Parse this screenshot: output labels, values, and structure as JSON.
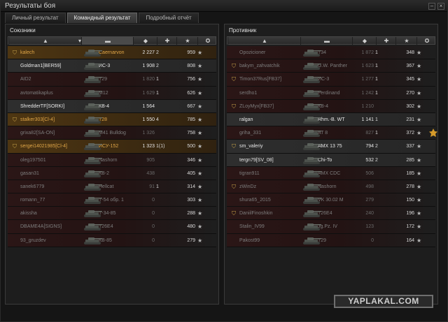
{
  "window": {
    "title": "Результаты боя"
  },
  "tabs": [
    {
      "label": "Личный результат",
      "active": false
    },
    {
      "label": "Командный результат",
      "active": true
    },
    {
      "label": "Подробный отчёт",
      "active": false
    }
  ],
  "allies": {
    "title": "Союзники",
    "players": [
      {
        "name": "kalech",
        "tank": "Caernarvon",
        "damage": "2 227",
        "frags": "2",
        "exp": "959",
        "platoon": true,
        "status": "me"
      },
      {
        "name": "Goldman1[BER59]",
        "tank": "ИС-3",
        "damage": "1 908",
        "frags": "2",
        "exp": "808",
        "platoon": false,
        "status": "alive"
      },
      {
        "name": "AID2",
        "tank": "T29",
        "damage": "1 820",
        "frags": "1",
        "exp": "756",
        "platoon": false,
        "status": "dead"
      },
      {
        "name": "avtomatikaplus",
        "tank": "M12",
        "damage": "1 629",
        "frags": "1",
        "exp": "626",
        "platoon": false,
        "status": "dead"
      },
      {
        "name": "ShredderTF[SORKI]",
        "tank": "КВ-4",
        "damage": "1 564",
        "frags": "",
        "exp": "667",
        "platoon": false,
        "status": "alive"
      },
      {
        "name": "stalker303[Cl-4]",
        "tank": "T28",
        "damage": "1 550",
        "frags": "4",
        "exp": "785",
        "platoon": true,
        "status": "me"
      },
      {
        "name": "grixa82[SA-ON]",
        "tank": "M41 Bulldog",
        "damage": "1 326",
        "frags": "",
        "exp": "758",
        "platoon": false,
        "status": "dead"
      },
      {
        "name": "sergei14021985[Cl-4]",
        "tank": "ИСУ-152",
        "damage": "1 323",
        "frags": "1(1)",
        "exp": "500",
        "platoon": true,
        "status": "me"
      },
      {
        "name": "oleg197501",
        "tank": "Nashorn",
        "damage": "905",
        "frags": "",
        "exp": "346",
        "platoon": false,
        "status": "dead"
      },
      {
        "name": "gasan31",
        "tank": "КВ-2",
        "damage": "438",
        "frags": "",
        "exp": "405",
        "platoon": false,
        "status": "dead"
      },
      {
        "name": "sanek6779",
        "tank": "Hellcat",
        "damage": "91",
        "frags": "1",
        "exp": "314",
        "platoon": false,
        "status": "dead"
      },
      {
        "name": "romann_77",
        "tank": "Т-54 обр. 1",
        "damage": "0",
        "frags": "",
        "exp": "303",
        "platoon": false,
        "status": "dead"
      },
      {
        "name": "akissha",
        "tank": "Т-34-85",
        "damage": "0",
        "frags": "",
        "exp": "288",
        "platoon": false,
        "status": "dead"
      },
      {
        "name": "DBAME4A[SIGNS]",
        "tank": "T26E4",
        "damage": "0",
        "frags": "",
        "exp": "480",
        "platoon": false,
        "status": "dead"
      },
      {
        "name": "93_gruzdev",
        "tank": "КВ-85",
        "damage": "0",
        "frags": "",
        "exp": "279",
        "platoon": false,
        "status": "dead"
      }
    ]
  },
  "enemies": {
    "title": "Противник",
    "players": [
      {
        "name": "Opozicioner",
        "tank": "T34",
        "damage": "1 872",
        "frags": "1",
        "exp": "348",
        "platoon": false,
        "status": "dead"
      },
      {
        "name": "bakym_zahvatchik",
        "tank": "G.W. Panther",
        "damage": "1 623",
        "frags": "1",
        "exp": "367",
        "platoon": true,
        "status": "dead"
      },
      {
        "name": "Timon37Rus[FB37]",
        "tank": "ИС-3",
        "damage": "1 277",
        "frags": "1",
        "exp": "345",
        "platoon": true,
        "status": "dead"
      },
      {
        "name": "serdho1",
        "tank": "Ferdinand",
        "damage": "1 242",
        "frags": "1",
        "exp": "270",
        "platoon": false,
        "status": "dead"
      },
      {
        "name": "ZLoyMyx[FB37]",
        "tank": "КВ-4",
        "damage": "1 210",
        "frags": "",
        "exp": "302",
        "platoon": true,
        "status": "dead"
      },
      {
        "name": "ralgan",
        "tank": "Rhm.-B. WT",
        "damage": "1 141",
        "frags": "1",
        "exp": "231",
        "platoon": false,
        "status": "alive"
      },
      {
        "name": "griha_331",
        "tank": "AT 8",
        "damage": "827",
        "frags": "1",
        "exp": "372",
        "platoon": false,
        "status": "dead",
        "medal": true
      },
      {
        "name": "sm_valeriy",
        "tank": "AMX 13 75",
        "damage": "794",
        "frags": "2",
        "exp": "337",
        "platoon": true,
        "status": "alive"
      },
      {
        "name": "tergn79[SV_08]",
        "tank": "Chi-To",
        "damage": "532",
        "frags": "2",
        "exp": "285",
        "platoon": false,
        "status": "alive"
      },
      {
        "name": "tigran911",
        "tank": "AMX CDC",
        "damage": "506",
        "frags": "",
        "exp": "185",
        "platoon": false,
        "status": "dead"
      },
      {
        "name": "zWinDz",
        "tank": "Nashorn",
        "damage": "498",
        "frags": "",
        "exp": "278",
        "platoon": true,
        "status": "dead"
      },
      {
        "name": "shura65_2015",
        "tank": "VK 30.02 M",
        "damage": "279",
        "frags": "",
        "exp": "150",
        "platoon": false,
        "status": "dead"
      },
      {
        "name": "DaniilFinoshkin",
        "tank": "T26E4",
        "damage": "240",
        "frags": "",
        "exp": "196",
        "platoon": true,
        "status": "dead"
      },
      {
        "name": "Stalin_IV99",
        "tank": "Jg.Pz. IV",
        "damage": "123",
        "frags": "",
        "exp": "172",
        "platoon": false,
        "status": "dead"
      },
      {
        "name": "Pakost99",
        "tank": "T29",
        "damage": "0",
        "frags": "",
        "exp": "164",
        "platoon": false,
        "status": "dead"
      }
    ]
  },
  "icons": {
    "platoon": "platoon-shield-icon",
    "tank": "tank-silhouette-icon",
    "star": "experience-star-icon",
    "medal": "medal-icon",
    "sort": "sort-chevron-down-icon"
  },
  "watermark": "YAPLAKAL.COM"
}
